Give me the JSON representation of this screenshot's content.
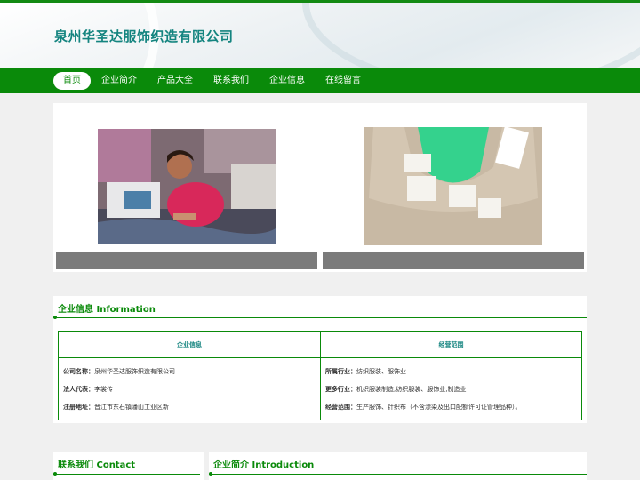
{
  "site": {
    "title": "泉州华圣达服饰织造有限公司"
  },
  "nav": {
    "items": [
      "首页",
      "企业简介",
      "产品大全",
      "联系我们",
      "企业信息",
      "在线留言"
    ]
  },
  "info_section": {
    "heading": "企业信息 Information",
    "left_header": "企业信息",
    "right_header": "经营范围",
    "left_rows": [
      {
        "label": "公司名称：",
        "value": "泉州华圣达服饰织造有限公司"
      },
      {
        "label": "法人代表：",
        "value": "李裳传"
      },
      {
        "label": "注册地址：",
        "value": "晋江市东石镇潘山工业区新"
      }
    ],
    "right_rows": [
      {
        "label": "所属行业：",
        "value": "纺织服装、服饰业"
      },
      {
        "label": "更多行业：",
        "value": "机织服装制造,纺织服装、服饰业,制造业"
      },
      {
        "label": "经营范围：",
        "value": "生产服饰、针织布（不含漂染及出口配额许可证管理品种）。"
      }
    ]
  },
  "contact": {
    "heading": "联系我们 Contact"
  },
  "intro": {
    "heading": "企业简介 Introduction"
  },
  "colors": {
    "brand_green": "#0a8a0a",
    "title_teal": "#14847f"
  }
}
